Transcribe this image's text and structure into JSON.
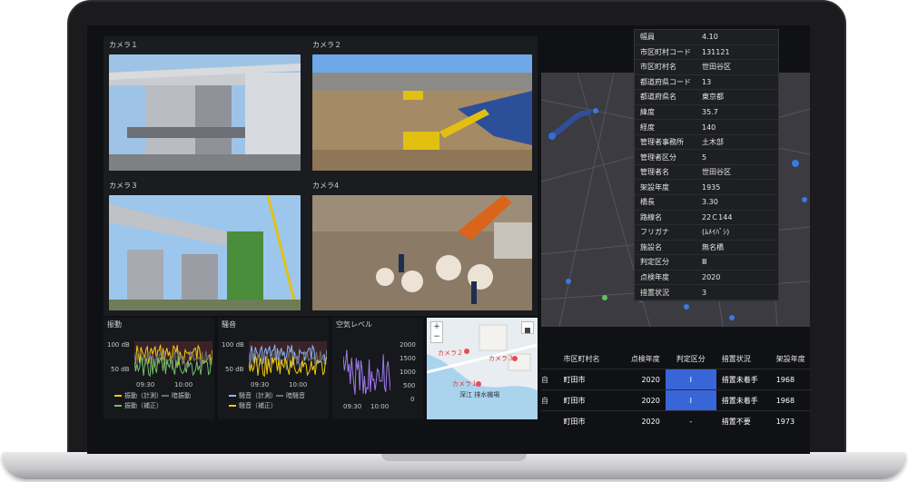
{
  "cameras": [
    {
      "label": "カメラ１"
    },
    {
      "label": "カメラ２"
    },
    {
      "label": "カメラ３"
    },
    {
      "label": "カメラ4"
    }
  ],
  "vibration": {
    "title": "振動",
    "y_ticks": [
      "100 dB",
      "50 dB"
    ],
    "x_ticks": [
      "09:30",
      "10:00"
    ],
    "legend": [
      "振動（計測）",
      "暗振動",
      "振動（補正）"
    ],
    "colors": [
      "#f2cc0c",
      "#6e6e6e",
      "#73bf69"
    ]
  },
  "noise": {
    "title": "騒音",
    "y_ticks": [
      "100 dB",
      "50 dB"
    ],
    "x_ticks": [
      "09:30",
      "10:00"
    ],
    "legend": [
      "騒音（計測）",
      "暗騒音",
      "騒音（補正）"
    ],
    "colors": [
      "#8ab8ff",
      "#6e6e6e",
      "#f2cc0c"
    ]
  },
  "air": {
    "title": "空気レベル",
    "y_ticks": [
      "2000",
      "1500",
      "1000",
      "500",
      "0"
    ],
    "x_ticks": [
      "09:30",
      "10:00"
    ],
    "color": "#9f7aea"
  },
  "minimap": {
    "zoom_in": "+",
    "zoom_out": "−",
    "markers": [
      "カメラ２",
      "カメラ３",
      "カメラ１"
    ],
    "place": "深江 排水機場"
  },
  "tooltip": [
    {
      "k": "幅員",
      "v": "4.10"
    },
    {
      "k": "市区町村コード",
      "v": "131121"
    },
    {
      "k": "市区町村名",
      "v": "世田谷区"
    },
    {
      "k": "都道府県コード",
      "v": "13"
    },
    {
      "k": "都道府県名",
      "v": "東京都"
    },
    {
      "k": "緯度",
      "v": "35.7"
    },
    {
      "k": "経度",
      "v": "140"
    },
    {
      "k": "管理者事務所",
      "v": "土木部"
    },
    {
      "k": "管理者区分",
      "v": "5"
    },
    {
      "k": "管理者名",
      "v": "世田谷区"
    },
    {
      "k": "架設年度",
      "v": "1935"
    },
    {
      "k": "橋長",
      "v": "3.30"
    },
    {
      "k": "路線名",
      "v": "22Ｃ144"
    },
    {
      "k": "フリガナ",
      "v": "(ﾑﾒｲﾊﾞｼ)"
    },
    {
      "k": "施設名",
      "v": "無名橋"
    },
    {
      "k": "判定区分",
      "v": "Ⅲ"
    },
    {
      "k": "点検年度",
      "v": "2020"
    },
    {
      "k": "措置状況",
      "v": "3"
    }
  ],
  "table": {
    "headers": [
      "市区町村名",
      "点検年度",
      "判定区分",
      "措置状況",
      "架設年度"
    ],
    "rows": [
      {
        "c0": "自",
        "city": "町田市",
        "year": "2020",
        "grade": "Ⅰ",
        "status": "措置未着手",
        "built": "1968",
        "hl": true
      },
      {
        "c0": "自",
        "city": "町田市",
        "year": "2020",
        "grade": "Ⅰ",
        "status": "措置未着手",
        "built": "1968",
        "hl": true
      },
      {
        "c0": "",
        "city": "町田市",
        "year": "2020",
        "grade": "-",
        "status": "措置不要",
        "built": "1973",
        "hl": false
      }
    ]
  }
}
